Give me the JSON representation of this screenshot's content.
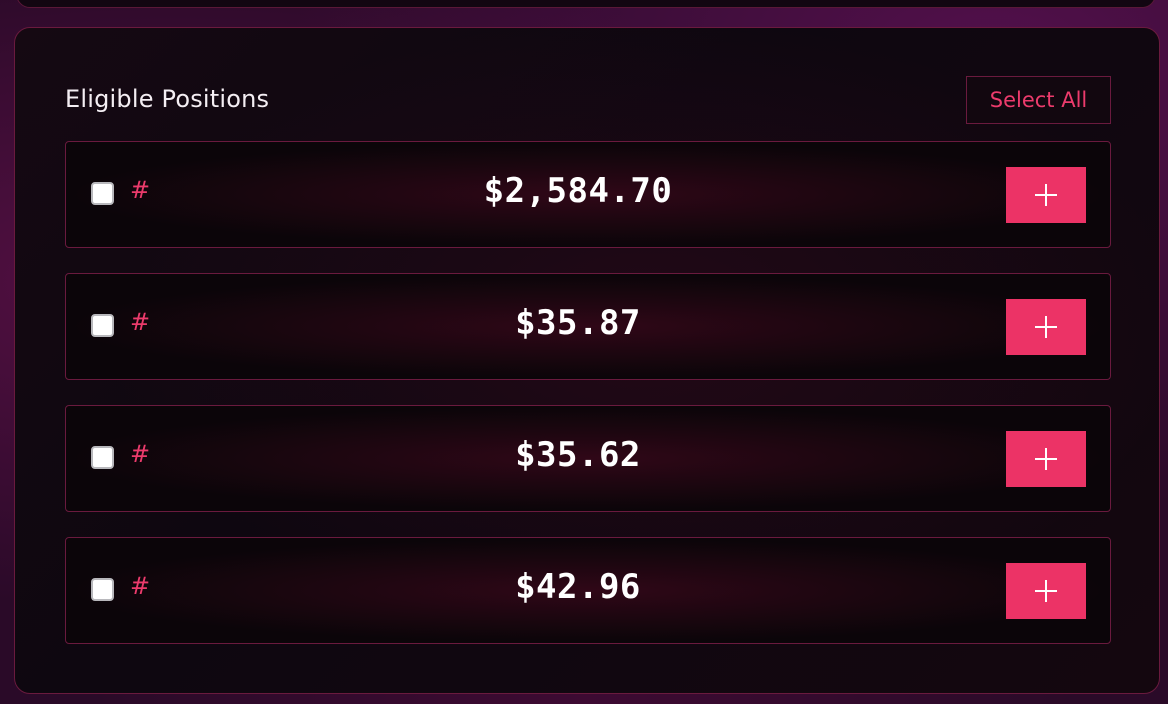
{
  "panel": {
    "title": "Eligible Positions",
    "select_all_label": "Select All"
  },
  "positions": [
    {
      "id_prefix": "#",
      "amount": "$2,584.70",
      "checked": false
    },
    {
      "id_prefix": "#",
      "amount": "$35.87",
      "checked": false
    },
    {
      "id_prefix": "#",
      "amount": "$35.62",
      "checked": false
    },
    {
      "id_prefix": "#",
      "amount": "$42.96",
      "checked": false
    }
  ],
  "icons": {
    "add": "plus-icon"
  },
  "colors": {
    "accent": "#ec3366",
    "accent_text": "#ec3b6c",
    "border": "#6a1a3e",
    "panel_bg": "#0e0710",
    "text": "#ffffff"
  }
}
